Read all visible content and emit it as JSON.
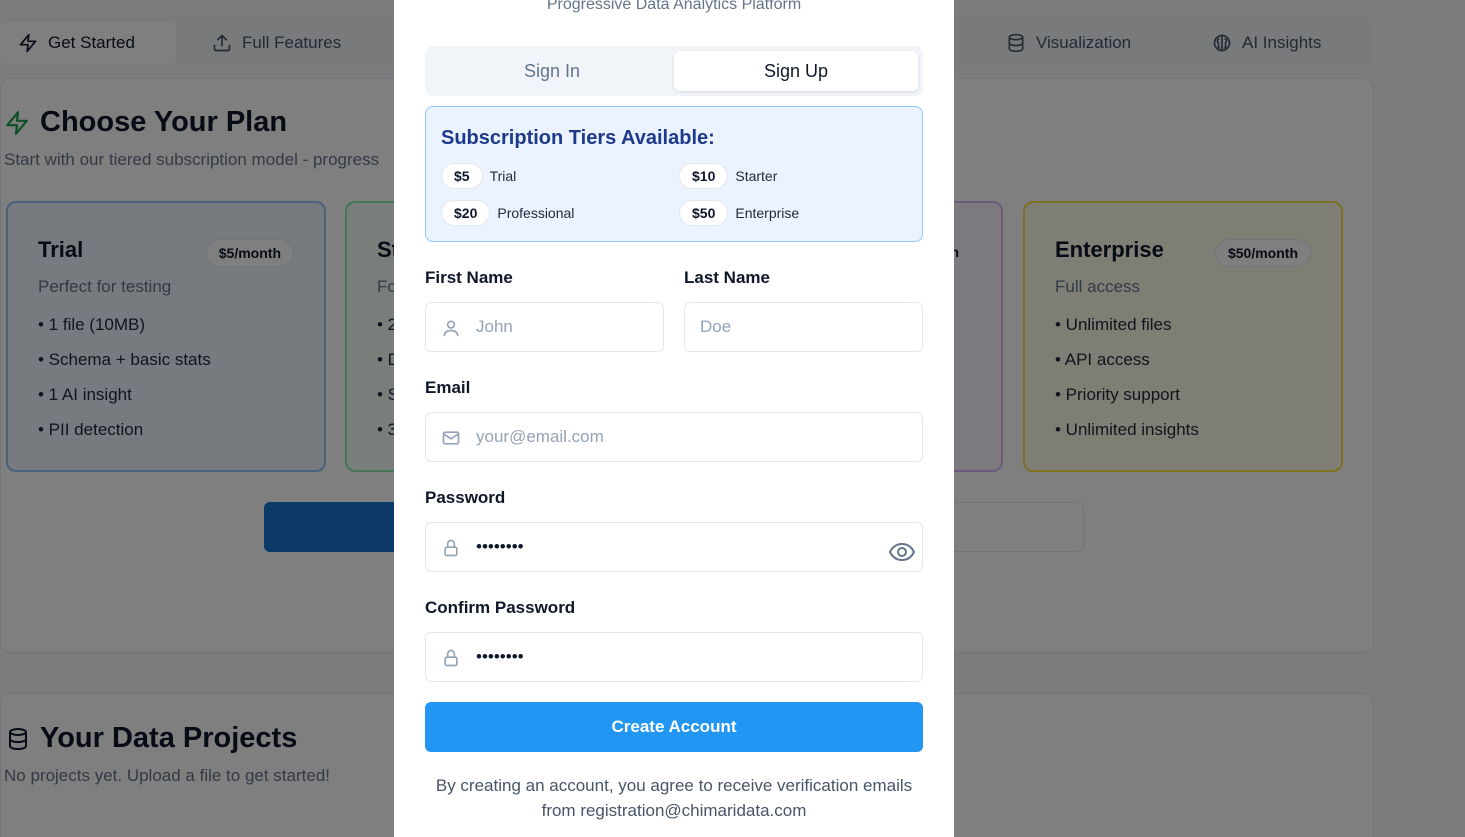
{
  "nav": {
    "tabs": [
      {
        "label": "Get Started",
        "icon": "zap-icon",
        "active": true
      },
      {
        "label": "Full Features",
        "icon": "upload-icon",
        "active": false
      },
      {
        "label": "Visualization",
        "icon": "database-icon",
        "active": false
      },
      {
        "label": "AI Insights",
        "icon": "brain-icon",
        "active": false
      }
    ]
  },
  "plans": {
    "title": "Choose Your Plan",
    "subtitle": "Start with our tiered subscription model - progress",
    "cards": [
      {
        "name": "Trial",
        "price": "$5/month",
        "desc": "Perfect for testing",
        "features": [
          "• 1 file (10MB)",
          "• Schema + basic stats",
          "• 1 AI insight",
          "• PII detection"
        ],
        "color": "#93c5fd",
        "bg": "#eef5ff"
      },
      {
        "name": "St",
        "price": "",
        "desc": "Fo",
        "features": [
          "• 2",
          "• D",
          "• S",
          "• 3"
        ],
        "color": "#86efac",
        "bg": "#f0fdf4"
      },
      {
        "name": "",
        "price": "n",
        "desc": "",
        "features": [],
        "color": "#d8b4fe",
        "bg": "#faf5ff"
      },
      {
        "name": "Enterprise",
        "price": "$50/month",
        "desc": "Full access",
        "features": [
          "• Unlimited files",
          "• API access",
          "• Priority support",
          "• Unlimited insights"
        ],
        "color": "#fde047",
        "bg": "#fefce8"
      }
    ]
  },
  "projects": {
    "title": "Your Data Projects",
    "empty": "No projects yet. Upload a file to get started!"
  },
  "modal": {
    "subtitle": "Progressive Data Analytics Platform",
    "tabs": {
      "sign_in": "Sign In",
      "sign_up": "Sign Up"
    },
    "tiers": {
      "heading": "Subscription Tiers Available:",
      "items": [
        {
          "price": "$5",
          "name": "Trial"
        },
        {
          "price": "$10",
          "name": "Starter"
        },
        {
          "price": "$20",
          "name": "Professional"
        },
        {
          "price": "$50",
          "name": "Enterprise"
        }
      ]
    },
    "form": {
      "first_name_label": "First Name",
      "first_name_placeholder": "John",
      "last_name_label": "Last Name",
      "last_name_placeholder": "Doe",
      "email_label": "Email",
      "email_placeholder": "your@email.com",
      "password_label": "Password",
      "password_value": "••••••••",
      "confirm_label": "Confirm Password",
      "confirm_value": "••••••••",
      "submit_label": "Create Account"
    },
    "terms": "By creating an account, you agree to receive verification emails from registration@chimaridata.com"
  },
  "colors": {
    "accent": "#2196f3",
    "overlay": "rgba(0,0,0,0.5)",
    "tier_bg": "#eaf3ff",
    "tier_heading": "#1e3a8a"
  }
}
